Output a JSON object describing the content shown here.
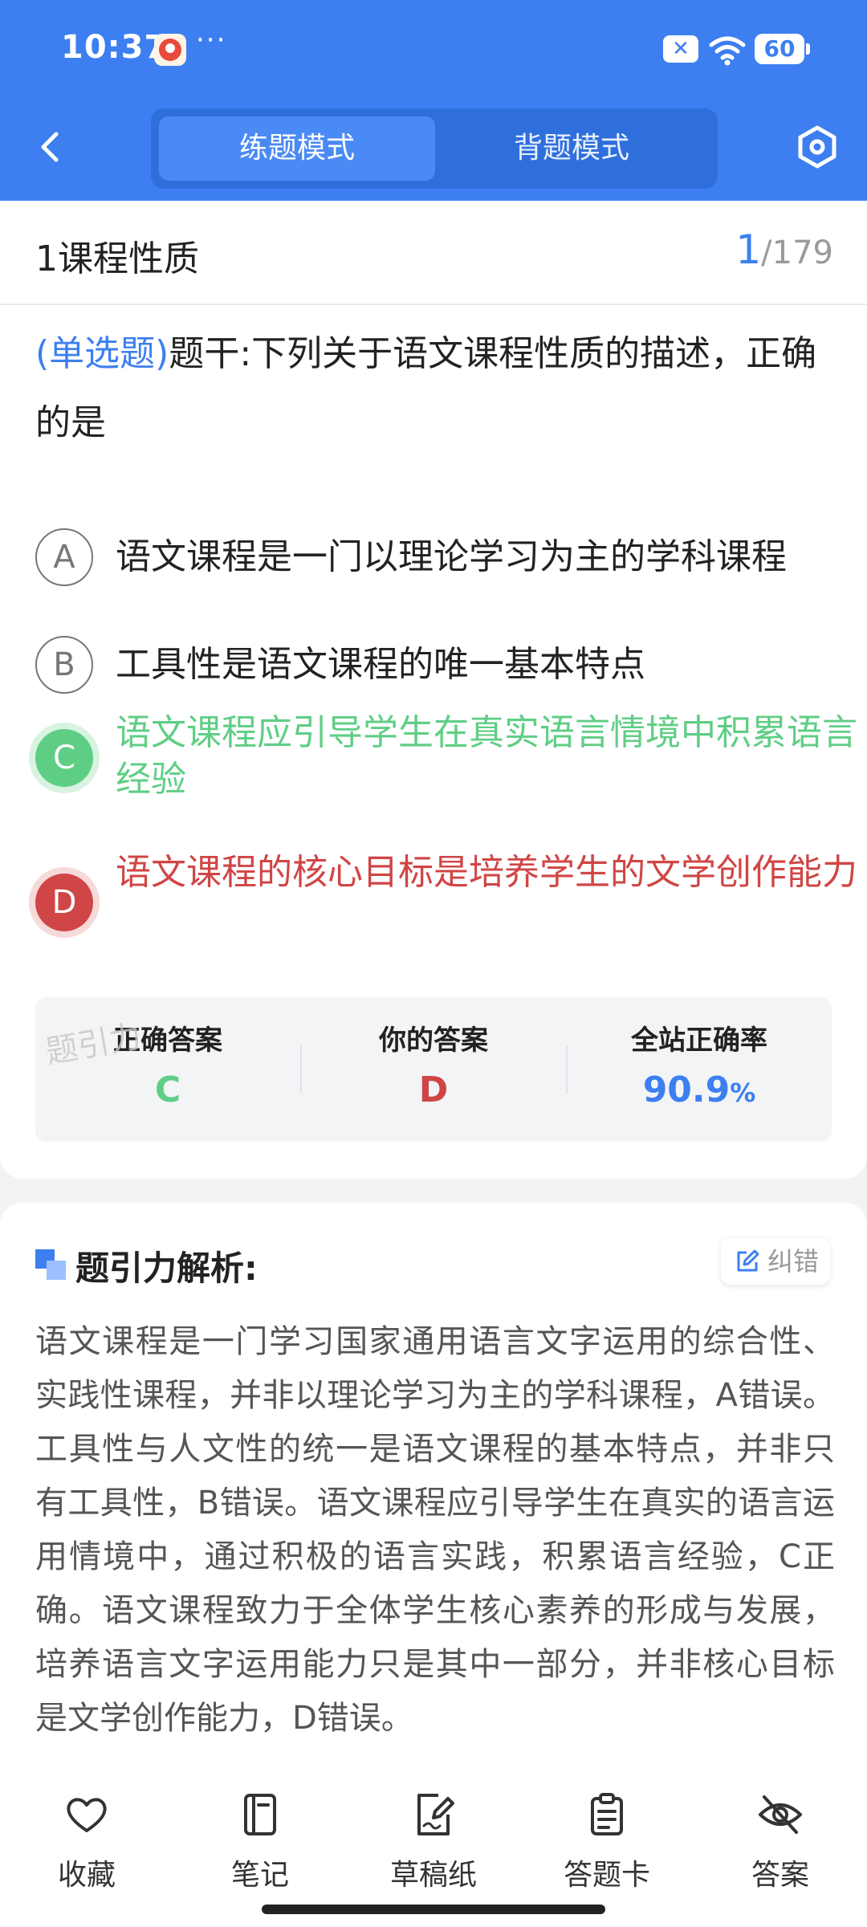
{
  "status_bar": {
    "time": "10:37",
    "more": "···",
    "battery": "60"
  },
  "nav": {
    "mode_practice": "练题模式",
    "mode_recite": "背题模式"
  },
  "question": {
    "chapter": "1课程性质",
    "current": "1",
    "total": "/179",
    "type": "(单选题)",
    "stem": "题干:下列关于语文课程性质的描述，正确的是",
    "options": [
      {
        "letter": "A",
        "text": "语文课程是一门以理论学习为主的学科课程"
      },
      {
        "letter": "B",
        "text": "工具性是语文课程的唯一基本特点"
      },
      {
        "letter": "C",
        "text": "语文课程应引导学生在真实语言情境中积累语言经验"
      },
      {
        "letter": "D",
        "text": "语文课程的核心目标是培养学生的文学创作能力"
      }
    ]
  },
  "result": {
    "correct_label": "正确答案",
    "correct_value": "C",
    "your_label": "你的答案",
    "your_value": "D",
    "rate_label": "全站正确率",
    "rate_value": "90.9",
    "rate_unit": "%",
    "watermark": "题引力"
  },
  "explanation": {
    "title": "题引力解析:",
    "report_label": "纠错",
    "text": "语文课程是一门学习国家通用语言文字运用的综合性、实践性课程，并非以理论学习为主的学科课程，A错误。工具性与人文性的统一是语文课程的基本特点，并非只有工具性，B错误。语文课程应引导学生在真实的语言运用情境中，通过积极的语言实践，积累语言经验，C正确。语文课程致力于全体学生核心素养的形成与发展，培养语言文字运用能力只是其中一部分，并非核心目标是文学创作能力，D错误。"
  },
  "toolbar": {
    "favorite": "收藏",
    "notes": "笔记",
    "draft": "草稿纸",
    "answer_card": "答题卡",
    "answer": "答案"
  },
  "colors": {
    "primary": "#3d7ff0",
    "correct": "#5fce85",
    "wrong": "#d04545"
  }
}
